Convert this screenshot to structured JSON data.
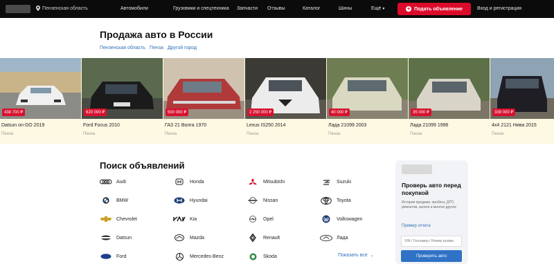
{
  "header": {
    "region": "Пензенская область",
    "nav": [
      "Автомобили",
      "Грузовики и спецтехника",
      "Запчасти",
      "Отзывы",
      "Каталог",
      "Шины",
      "Ещё"
    ],
    "post_button": "Подать объявление",
    "login": "Вход и регистрация"
  },
  "page": {
    "title": "Продажа авто в России",
    "filters": [
      "Пензенская область",
      "Пенза",
      "Другой город"
    ]
  },
  "listings": [
    {
      "price": "438 700 ₽",
      "title": "Datsun on-DO 2019",
      "city": "Пенза",
      "color": "#f0f0f0"
    },
    {
      "price": "620 000 ₽",
      "title": "Ford Focus 2010",
      "city": "Пенза",
      "color": "#1b1b1b"
    },
    {
      "price": "500 000 ₽",
      "title": "ГАЗ 21 Волга 1970",
      "city": "Пенза",
      "color": "#b03a3a"
    },
    {
      "price": "2 250 000 ₽",
      "title": "Lexus IS250 2014",
      "city": "Пенза",
      "color": "#ececec"
    },
    {
      "price": "40 000 ₽",
      "title": "Лада 21099 2003",
      "city": "Пенза",
      "color": "#d9d9c2"
    },
    {
      "price": "35 000 ₽",
      "title": "Лада 21099 1996",
      "city": "Пенза",
      "color": "#d8d5c8"
    },
    {
      "price": "339 000 ₽",
      "title": "4x4 2121 Нива 2015",
      "city": "Пенза",
      "color": "#1e1e24"
    }
  ],
  "search": {
    "title": "Поиск объявлений",
    "brands": [
      [
        "Audi",
        "BMW",
        "Chevrolet",
        "Datsun",
        "Ford"
      ],
      [
        "Honda",
        "Hyundai",
        "Kia",
        "Mazda",
        "Mercedes-Benz"
      ],
      [
        "Mitsubishi",
        "Nissan",
        "Opel",
        "Renault",
        "Skoda"
      ],
      [
        "Suzuki",
        "Toyota",
        "Volkswagen",
        "Лада"
      ]
    ],
    "show_all": "Показать все"
  },
  "panel": {
    "title": "Проверь авто перед покупкой",
    "text": "История продажи, пробега, ДТП, ремонтов, залога и многое другое",
    "link": "Пример отчета",
    "vin_placeholder": "VIN / Госномер / Номер кузова",
    "button": "Проверить авто"
  },
  "colors": {
    "accent": "#db0b2b",
    "link": "#2f6fb6",
    "panel_button": "#2f72c6",
    "topbar": "#0b0b0b"
  }
}
